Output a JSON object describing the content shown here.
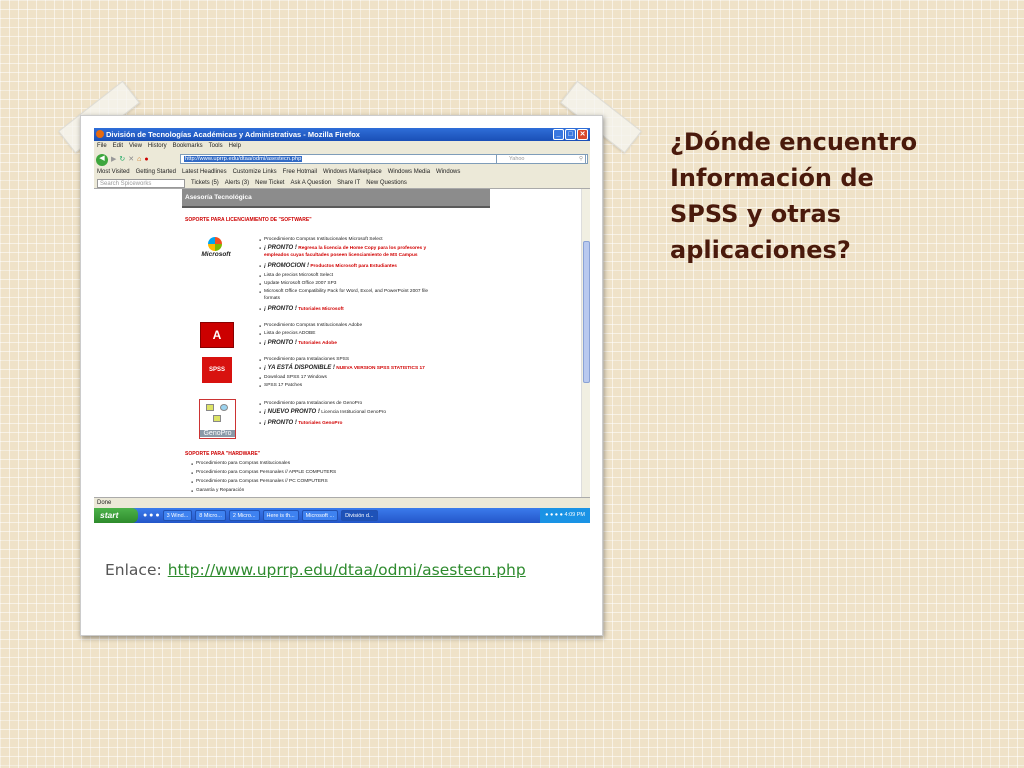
{
  "slide": {
    "title_lines": [
      "¿Dónde encuentro",
      "Información de",
      "SPSS y otras",
      "aplicaciones?"
    ],
    "caption_label": "Enlace:",
    "caption_link": "http://www.uprrp.edu/dtaa/odmi/asestecn.php"
  },
  "browser": {
    "window_title": "División de Tecnologías Académicas y Administrativas - Mozilla Firefox",
    "menu": [
      "File",
      "Edit",
      "View",
      "History",
      "Bookmarks",
      "Tools",
      "Help"
    ],
    "url": "http://www.uprrp.edu/dtaa/odmi/asestecn.php",
    "search_engine_placeholder": "Yahoo",
    "bookmarks": [
      "Most Visited",
      "Getting Started",
      "Latest Headlines",
      "Customize Links",
      "Free Hotmail",
      "Windows Marketplace",
      "Windows Media",
      "Windows"
    ],
    "toolbar2": {
      "search_placeholder": "Search Spiceworks",
      "items": [
        "Tickets (5)",
        "Alerts (3)",
        "New Ticket",
        "Ask A Question",
        "Share IT",
        "New Questions"
      ]
    },
    "status": "Done"
  },
  "page": {
    "header": "Asesoría Tecnológica",
    "software_heading": "SOPORTE PARA LICENCIAMIENTO DE \"SOFTWARE\"",
    "microsoft": {
      "logo_text": "Microsoft",
      "items": [
        "Procedimiento Compras Institucionales Microsoft Select"
      ],
      "pronto_label": "¡ PRONTO !",
      "pronto_link_1": "Regresa la licencia de Home Copy para los profesores y",
      "pronto_link_2": "empleados cuyas facultades poseen licenciamiento de MS Campus",
      "promo_label": "¡ PROMOCION !",
      "promo_link": "Productos Microsoft para Estudiantes",
      "items2": [
        "Lista de precios Microsoft Select",
        "Update Microsoft Office 2007 SP3",
        "Microsoft Office Compatibility Pack for Word, Excel, and PowerPoint 2007 file",
        "formats"
      ],
      "tut_label": "¡ PRONTO !",
      "tut_link": "Tutoriales Microsoft"
    },
    "adobe": {
      "items": [
        "Procedimiento Compras Institucionales Adobe",
        "Lista de precios ADOBE"
      ],
      "tut_label": "¡ PRONTO !",
      "tut_link": "Tutoriales Adobe"
    },
    "spss": {
      "logo_text": "SPSS",
      "items": [
        "Procedimiento para Instalaciones SPSS"
      ],
      "ya_label": "¡ YA ESTÁ DISPONIBLE !",
      "ya_link": "NUEVA VERSION SPSS STATISTICS 17",
      "items2": [
        "Download SPSS 17 Windows",
        "SPSS 17 Patches"
      ]
    },
    "genopro": {
      "logo_text": "GenoPro",
      "items": [
        "Procedimiento para Instalaciones de GenoPro"
      ],
      "nuevo_label": "¡ NUEVO PRONTO !",
      "nuevo_text": "Licencia Institucional GenoPro",
      "tut_label": "¡ PRONTO !",
      "tut_link": "Tutoriales GenoPro"
    },
    "hardware_heading": "SOPORTE PARA \"HARDWARE\"",
    "hardware_items": [
      "Procedimiento para Compras Institucionales",
      "Procedimiento para Compras Personales // APPLE COMPUTERS",
      "Procedimiento para Compras Personales // PC COMPUTERS",
      "Garantía y Reparación"
    ]
  },
  "taskbar": {
    "start": "start",
    "buttons": [
      "3 Wind...",
      "8 Micro...",
      "2 Micro...",
      "Here is th...",
      "Microsoft ...",
      "División d..."
    ],
    "clock": "4:09 PM"
  }
}
